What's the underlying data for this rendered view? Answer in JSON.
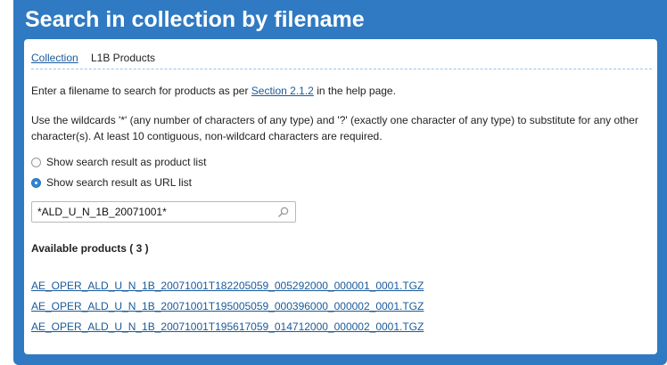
{
  "title": "Search in collection by filename",
  "breadcrumb": {
    "collection_label": "Collection",
    "current_label": "L1B Products"
  },
  "instructions": {
    "line1_before": "Enter a filename to search for products as per ",
    "line1_link": "Section 2.1.2",
    "line1_after": " in the help page.",
    "line2": "Use the wildcards '*' (any number of characters of any type) and '?' (exactly one character of any type) to substitute for any other character(s). At least 10 contiguous, non-wildcard characters are required."
  },
  "options": {
    "product_list_label": "Show search result as product list",
    "url_list_label": "Show search result as URL list",
    "selected": "url_list"
  },
  "search": {
    "value": "*ALD_U_N_1B_20071001*",
    "icon": "search-icon"
  },
  "results": {
    "heading": "Available products ( 3 )",
    "items": [
      "AE_OPER_ALD_U_N_1B_20071001T182205059_005292000_000001_0001.TGZ",
      "AE_OPER_ALD_U_N_1B_20071001T195005059_000396000_000002_0001.TGZ",
      "AE_OPER_ALD_U_N_1B_20071001T195617059_014712000_000002_0001.TGZ"
    ]
  },
  "colors": {
    "header_blue": "#2f7ac2",
    "link_blue": "#1a5a9a",
    "radio_selected": "#2f86d6"
  }
}
